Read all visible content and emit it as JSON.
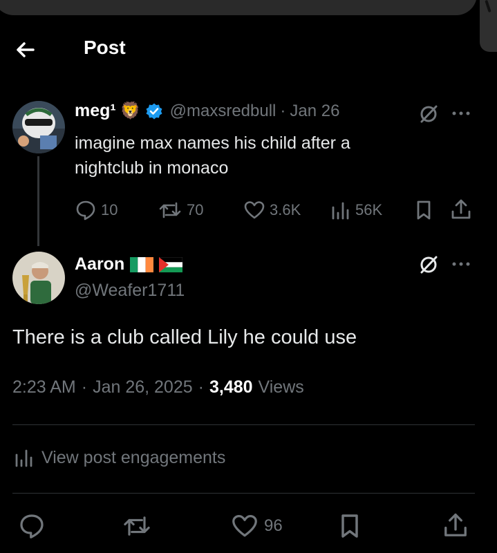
{
  "header": {
    "title": "Post"
  },
  "parent_post": {
    "display_name": "meg¹",
    "name_emoji": "🦁",
    "handle": "@maxsredbull",
    "separator": "·",
    "date": "Jan 26",
    "text_line1": "imagine max names his child after a",
    "text_line2": "nightclub in monaco",
    "replies": "10",
    "reposts": "70",
    "likes": "3.6K",
    "views": "56K"
  },
  "main_post": {
    "display_name": "Aaron",
    "handle": "@Weafer1711",
    "text": "There is a club called Lily he could use",
    "time": "2:23 AM",
    "sep1": "·",
    "date": "Jan 26, 2025",
    "sep2": "·",
    "views_count": "3,480",
    "views_label": "Views",
    "engagements_label": "View post engagements",
    "likes": "96"
  },
  "colors": {
    "background": "#000000",
    "text": "#e7e9ea",
    "muted": "#71767b",
    "verified": "#1d9bf0",
    "divider": "#2f3336"
  },
  "icons": [
    "back-arrow-icon",
    "verified-badge-icon",
    "grok-icon",
    "more-icon",
    "reply-icon",
    "repost-icon",
    "like-icon",
    "views-icon",
    "bookmark-icon",
    "share-icon",
    "irish-flag-icon",
    "palestinian-flag-icon"
  ]
}
